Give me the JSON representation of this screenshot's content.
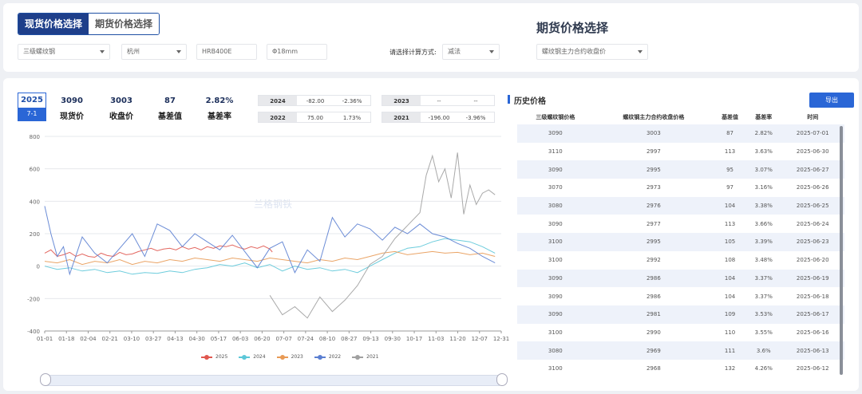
{
  "tabs": [
    {
      "label": "现货价格选择",
      "active": true
    },
    {
      "label": "期货价格选择",
      "active": false
    }
  ],
  "futures_title": "期货价格选择",
  "spot_filters": {
    "product": "三级螺纹钢",
    "city": "杭州",
    "grade": "HRB400E",
    "spec": "Φ18mm"
  },
  "calc": {
    "label": "请选择计算方式:",
    "value": "减法"
  },
  "futures_select": "螺纹钢主力合约收盘价",
  "current_date": {
    "year": "2025",
    "day": "7-1"
  },
  "stats": [
    {
      "value": "3090",
      "label": "现货价"
    },
    {
      "value": "3003",
      "label": "收盘价"
    },
    {
      "value": "87",
      "label": "基差值"
    },
    {
      "value": "2.82%",
      "label": "基差率"
    }
  ],
  "year_cards": [
    {
      "year": "2024",
      "basis": "-82.00",
      "rate": "-2.36%"
    },
    {
      "year": "2023",
      "basis": "--",
      "rate": "--"
    },
    {
      "year": "2022",
      "basis": "75.00",
      "rate": "1.73%"
    },
    {
      "year": "2021",
      "basis": "-196.00",
      "rate": "-3.96%"
    }
  ],
  "history": {
    "title": "历史价格",
    "export_label": "导出",
    "columns": [
      "三级螺纹钢价格",
      "螺纹钢主力合约收盘价格",
      "基差值",
      "基差率",
      "时间"
    ],
    "rows": [
      [
        "3090",
        "3003",
        "87",
        "2.82%",
        "2025-07-01"
      ],
      [
        "3110",
        "2997",
        "113",
        "3.63%",
        "2025-06-30"
      ],
      [
        "3090",
        "2995",
        "95",
        "3.07%",
        "2025-06-27"
      ],
      [
        "3070",
        "2973",
        "97",
        "3.16%",
        "2025-06-26"
      ],
      [
        "3080",
        "2976",
        "104",
        "3.38%",
        "2025-06-25"
      ],
      [
        "3090",
        "2977",
        "113",
        "3.66%",
        "2025-06-24"
      ],
      [
        "3100",
        "2995",
        "105",
        "3.39%",
        "2025-06-23"
      ],
      [
        "3100",
        "2992",
        "108",
        "3.48%",
        "2025-06-20"
      ],
      [
        "3090",
        "2986",
        "104",
        "3.37%",
        "2025-06-19"
      ],
      [
        "3090",
        "2986",
        "104",
        "3.37%",
        "2025-06-18"
      ],
      [
        "3090",
        "2981",
        "109",
        "3.53%",
        "2025-06-17"
      ],
      [
        "3100",
        "2990",
        "110",
        "3.55%",
        "2025-06-16"
      ],
      [
        "3080",
        "2969",
        "111",
        "3.6%",
        "2025-06-13"
      ],
      [
        "3100",
        "2968",
        "132",
        "4.26%",
        "2025-06-12"
      ]
    ]
  },
  "watermark": "兰格钢铁",
  "chart_data": {
    "type": "line",
    "x_ticks": [
      "01-01",
      "01-18",
      "02-04",
      "02-21",
      "03-10",
      "03-27",
      "04-13",
      "04-30",
      "05-17",
      "06-03",
      "06-20",
      "07-07",
      "07-24",
      "08-10",
      "08-27",
      "09-13",
      "09-30",
      "10-17",
      "11-03",
      "11-20",
      "12-07",
      "12-31"
    ],
    "y_ticks": [
      800,
      600,
      400,
      200,
      0,
      -200,
      -400
    ],
    "ylim": [
      -400,
      800
    ],
    "grid": true,
    "legend_position": "bottom",
    "series": [
      {
        "name": "2025",
        "color": "#e0574f",
        "points": [
          [
            0,
            80
          ],
          [
            5,
            100
          ],
          [
            10,
            60
          ],
          [
            15,
            70
          ],
          [
            20,
            85
          ],
          [
            25,
            60
          ],
          [
            30,
            75
          ],
          [
            35,
            60
          ],
          [
            40,
            55
          ],
          [
            45,
            80
          ],
          [
            50,
            65
          ],
          [
            55,
            60
          ],
          [
            60,
            85
          ],
          [
            65,
            70
          ],
          [
            70,
            75
          ],
          [
            75,
            90
          ],
          [
            80,
            100
          ],
          [
            85,
            110
          ],
          [
            90,
            95
          ],
          [
            95,
            105
          ],
          [
            100,
            110
          ],
          [
            105,
            100
          ],
          [
            110,
            120
          ],
          [
            115,
            105
          ],
          [
            120,
            115
          ],
          [
            125,
            100
          ],
          [
            130,
            120
          ],
          [
            135,
            110
          ],
          [
            140,
            125
          ],
          [
            145,
            120
          ],
          [
            150,
            130
          ],
          [
            155,
            115
          ],
          [
            160,
            105
          ],
          [
            165,
            120
          ],
          [
            170,
            110
          ],
          [
            175,
            125
          ],
          [
            180,
            105
          ],
          [
            182,
            87
          ]
        ]
      },
      {
        "name": "2024",
        "color": "#5cc7d8",
        "points": [
          [
            0,
            0
          ],
          [
            10,
            -20
          ],
          [
            20,
            -10
          ],
          [
            30,
            -30
          ],
          [
            40,
            -20
          ],
          [
            50,
            -40
          ],
          [
            60,
            -30
          ],
          [
            70,
            -50
          ],
          [
            80,
            -40
          ],
          [
            90,
            -45
          ],
          [
            100,
            -30
          ],
          [
            110,
            -40
          ],
          [
            120,
            -20
          ],
          [
            130,
            -10
          ],
          [
            140,
            10
          ],
          [
            150,
            0
          ],
          [
            160,
            20
          ],
          [
            170,
            -10
          ],
          [
            180,
            10
          ],
          [
            190,
            -30
          ],
          [
            200,
            0
          ],
          [
            210,
            -20
          ],
          [
            220,
            -10
          ],
          [
            230,
            -30
          ],
          [
            240,
            -20
          ],
          [
            250,
            -40
          ],
          [
            260,
            0
          ],
          [
            270,
            40
          ],
          [
            280,
            80
          ],
          [
            290,
            110
          ],
          [
            300,
            120
          ],
          [
            310,
            150
          ],
          [
            320,
            170
          ],
          [
            330,
            160
          ],
          [
            340,
            150
          ],
          [
            350,
            120
          ],
          [
            360,
            80
          ]
        ]
      },
      {
        "name": "2023",
        "color": "#e89a55",
        "points": [
          [
            0,
            30
          ],
          [
            10,
            20
          ],
          [
            20,
            40
          ],
          [
            30,
            10
          ],
          [
            40,
            30
          ],
          [
            50,
            20
          ],
          [
            60,
            40
          ],
          [
            70,
            10
          ],
          [
            80,
            30
          ],
          [
            90,
            20
          ],
          [
            100,
            40
          ],
          [
            110,
            30
          ],
          [
            120,
            50
          ],
          [
            130,
            40
          ],
          [
            140,
            30
          ],
          [
            150,
            50
          ],
          [
            160,
            40
          ],
          [
            170,
            30
          ],
          [
            180,
            50
          ],
          [
            190,
            40
          ],
          [
            200,
            30
          ],
          [
            210,
            20
          ],
          [
            220,
            40
          ],
          [
            230,
            30
          ],
          [
            240,
            50
          ],
          [
            250,
            40
          ],
          [
            260,
            60
          ],
          [
            270,
            80
          ],
          [
            280,
            90
          ],
          [
            290,
            70
          ],
          [
            300,
            80
          ],
          [
            310,
            90
          ],
          [
            320,
            80
          ],
          [
            330,
            85
          ],
          [
            340,
            70
          ],
          [
            350,
            80
          ],
          [
            360,
            60
          ]
        ]
      },
      {
        "name": "2022",
        "color": "#5b7fd1",
        "points": [
          [
            0,
            370
          ],
          [
            5,
            200
          ],
          [
            10,
            60
          ],
          [
            15,
            120
          ],
          [
            20,
            -50
          ],
          [
            30,
            180
          ],
          [
            40,
            80
          ],
          [
            50,
            20
          ],
          [
            60,
            110
          ],
          [
            70,
            200
          ],
          [
            80,
            60
          ],
          [
            90,
            260
          ],
          [
            100,
            220
          ],
          [
            110,
            120
          ],
          [
            120,
            200
          ],
          [
            130,
            150
          ],
          [
            140,
            100
          ],
          [
            150,
            190
          ],
          [
            160,
            90
          ],
          [
            170,
            -10
          ],
          [
            180,
            110
          ],
          [
            190,
            150
          ],
          [
            200,
            -40
          ],
          [
            210,
            100
          ],
          [
            220,
            30
          ],
          [
            230,
            300
          ],
          [
            240,
            180
          ],
          [
            250,
            260
          ],
          [
            260,
            230
          ],
          [
            270,
            160
          ],
          [
            280,
            240
          ],
          [
            290,
            200
          ],
          [
            300,
            260
          ],
          [
            310,
            200
          ],
          [
            320,
            180
          ],
          [
            330,
            140
          ],
          [
            340,
            110
          ],
          [
            350,
            60
          ],
          [
            360,
            20
          ]
        ]
      },
      {
        "name": "2021",
        "color": "#a0a0a0",
        "points": [
          [
            180,
            -180
          ],
          [
            190,
            -300
          ],
          [
            200,
            -250
          ],
          [
            210,
            -320
          ],
          [
            220,
            -190
          ],
          [
            230,
            -280
          ],
          [
            240,
            -210
          ],
          [
            250,
            -120
          ],
          [
            260,
            10
          ],
          [
            270,
            60
          ],
          [
            280,
            170
          ],
          [
            290,
            250
          ],
          [
            300,
            330
          ],
          [
            305,
            560
          ],
          [
            310,
            680
          ],
          [
            315,
            520
          ],
          [
            320,
            600
          ],
          [
            325,
            420
          ],
          [
            330,
            700
          ],
          [
            335,
            320
          ],
          [
            340,
            500
          ],
          [
            345,
            380
          ],
          [
            350,
            450
          ],
          [
            355,
            470
          ],
          [
            360,
            440
          ]
        ]
      }
    ]
  }
}
